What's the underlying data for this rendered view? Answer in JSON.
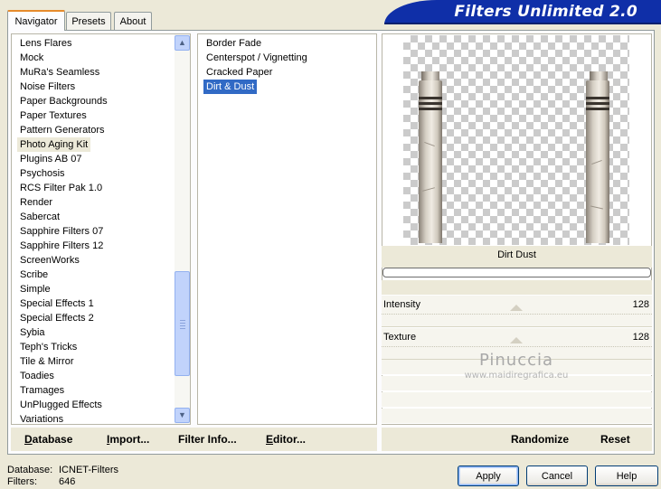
{
  "tabs": [
    {
      "label": "Navigator",
      "active": true
    },
    {
      "label": "Presets",
      "active": false
    },
    {
      "label": "About",
      "active": false
    }
  ],
  "banner_title": "Filters Unlimited 2.0",
  "categories": [
    "Lens Flares",
    "Mock",
    "MuRa's Seamless",
    "Noise Filters",
    "Paper Backgrounds",
    "Paper Textures",
    "Pattern Generators",
    "Photo Aging Kit",
    "Plugins AB 07",
    "Psychosis",
    "RCS Filter Pak 1.0",
    "Render",
    "Sabercat",
    "Sapphire Filters 07",
    "Sapphire Filters 12",
    "ScreenWorks",
    "Scribe",
    "Simple",
    "Special Effects 1",
    "Special Effects 2",
    "Sybia",
    "Teph's Tricks",
    "Tile & Mirror",
    "Toadies",
    "Tramages",
    "UnPlugged Effects",
    "Variations"
  ],
  "selected_category": "Photo Aging Kit",
  "filters": [
    "Border Fade",
    "Centerspot / Vignetting",
    "Cracked Paper",
    "Dirt & Dust"
  ],
  "selected_filter": "Dirt & Dust",
  "filter_name_display": "Dirt  Dust",
  "parameters": [
    {
      "label": "Intensity",
      "value": "128"
    },
    {
      "label": "Texture",
      "value": "128"
    }
  ],
  "watermark": {
    "name": "Pinuccia",
    "url": "www.maidiregrafica.eu"
  },
  "bottom_left_buttons": [
    {
      "underline": "D",
      "rest": "atabase"
    },
    {
      "underline": "I",
      "rest": "mport..."
    },
    {
      "underline": "",
      "rest": "Filter Info..."
    },
    {
      "underline": "E",
      "rest": "ditor..."
    }
  ],
  "bottom_right_buttons": [
    "Randomize",
    "Reset"
  ],
  "status": {
    "database_label": "Database:",
    "database_value": "ICNET-Filters",
    "filters_label": "Filters:",
    "filters_value": "646"
  },
  "dialog_buttons": [
    "Apply",
    "Cancel",
    "Help"
  ],
  "scroll_up_icon": "up-arrow-icon",
  "scroll_down_icon": "down-arrow-icon"
}
